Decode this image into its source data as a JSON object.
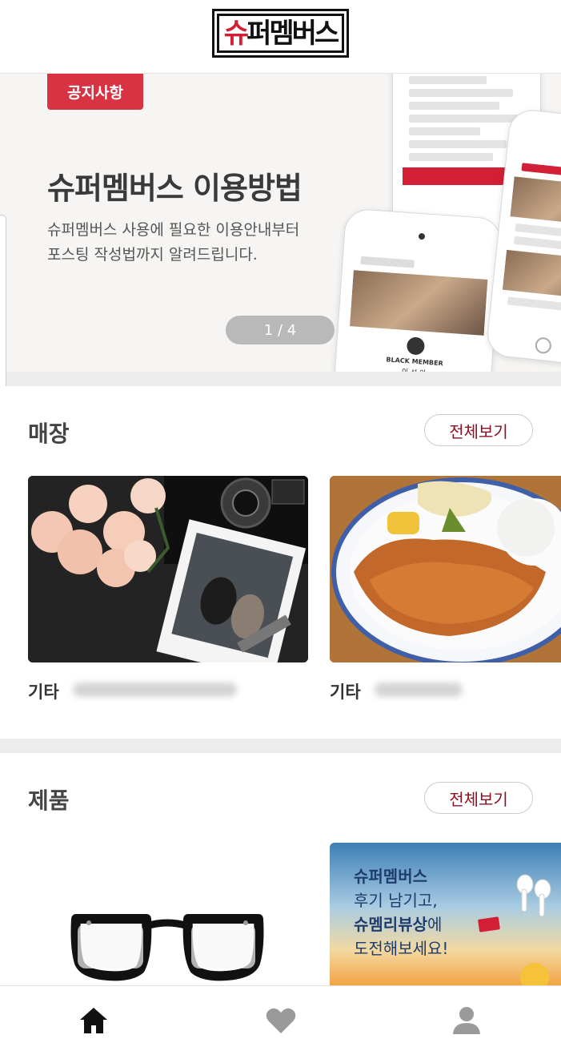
{
  "header": {
    "logo_text": "슈퍼멤버스",
    "logo_accent": "슈",
    "logo_rest": "퍼멤버스"
  },
  "banner": {
    "tag": "공지사항",
    "title": "슈퍼멤버스 이용방법",
    "desc_line1": "슈퍼멤버스 사용에 필요한 이용안내부터",
    "desc_line2": "포스팅 작성법까지 알려드립니다.",
    "pager": "1 / 4",
    "phone_text_1": "BLACK MEMBER",
    "phone_text_2": "이 선 아"
  },
  "stores": {
    "title": "매장",
    "view_all": "전체보기",
    "items": [
      {
        "category": "기타"
      },
      {
        "category": "기타"
      }
    ]
  },
  "products": {
    "title": "제품",
    "view_all": "전체보기",
    "promo_line1": "슈퍼멤버스",
    "promo_line2": "후기 남기고,",
    "promo_line3_bold": "슈멤리뷰상",
    "promo_line3_rest": "에",
    "promo_line4": "도전해보세요!"
  },
  "colors": {
    "accent": "#d21f36",
    "view_all_text": "#8b1020",
    "notice_tag": "#d83343"
  },
  "nav": {
    "icons": [
      "home-icon",
      "heart-icon",
      "person-icon"
    ]
  }
}
